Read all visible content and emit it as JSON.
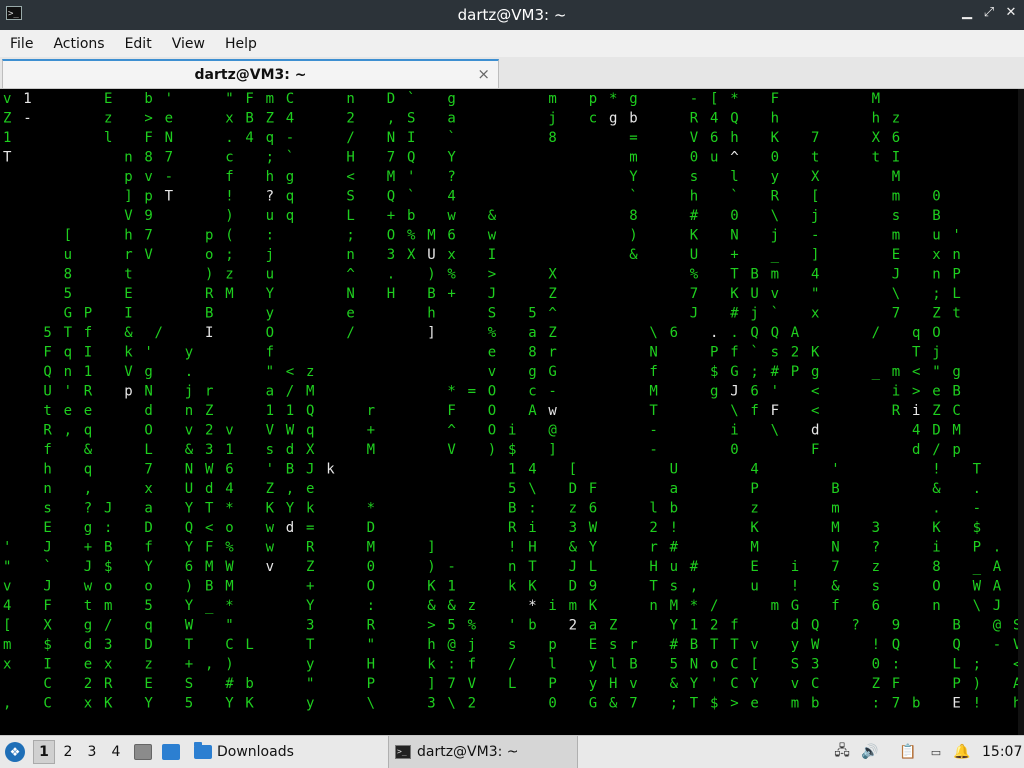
{
  "window": {
    "title": "dartz@VM3: ~",
    "app_icon_glyph": ">_",
    "min_glyph": "▁",
    "max_glyph": "⤢",
    "close_glyph": "✕"
  },
  "menu": {
    "items": [
      "File",
      "Actions",
      "Edit",
      "View",
      "Help"
    ]
  },
  "tab": {
    "label": "dartz@VM3: ~",
    "close_glyph": "×"
  },
  "terminal": {
    "fg_green": "#1fcf1f",
    "fg_white": "#e8e8e8",
    "bg": "#000000",
    "rows": [
      "v 1       E   b '     \" F m C     n   D `   g         m   p * g     - [ *   F         M",
      "Z -       z   > e     x B Z 4     2   , S   a         j   c g b     R 4 Q   h         h z",
      "1         l   F N     . 4 q -     /   N I   `         8       =     V 6 h   K   7     X 6",
      "T           n 8 7     c   ; `     H   7 Q   Y                 m     0 u ^   0   t     t I",
      "            p v -     f   h g     <   M '   ?                 Y     s   l   y   X       M",
      "            ] p T     !   ? q     S   Q `   4                 `     h   `   R   [       m   0",
      "            V 9       )   u q     L   + b   w   &             8     #   0   \\   j       s   B",
      "      [     h 7     p (   :       ;   O % M 6   w             )     K   N   j   -       m   u '",
      "      u     r V     o ;   j       n   3 X U x   I             &     U   +   _   ]       E   x n",
      "      8     t       ) z   u       ^   .   ) %   >     X             %   T B m   4       J   n P",
      "      5     E       R M   Y       N   H   B +   J     Z             7   K U v   \"       \\   ; L",
      "      G P   I       B     y       e       h     S   5 ^             J   # j `   x       7   Z t",
      "    5 T f   &  /    I     O       /       ]     %   a Z         \\ 6   . . Q Q A       /   q O",
      "    F q I   k '   y       f                     e   8 r         N     P f ` s 2 K         T j",
      "    Q n 1   V g   .       \" < z                 v   g G         f     $ G ; # P g     _ m < \" g",
      "    U ' R   p N   j r     a / M             * = O   c -         M     g J 6 '   <       i > e B",
      "    t e e     d   n Z     1 1 Q     r       F   O   A w         T       \\ f F   <       R i Z C",
      "    R , q     O   v 2 v   V W q     +       ^   O i   @         -       i   \\   d         4 D M",
      "    f   &     L   & 3 1   s d X     M       V   ) $   ]         -       0       F         d / p",
      "    h   q     7   N W 6   ' B J k                 1 4   [         U       4       '         !   T",
      "    n   ,     x   U d 4   Z , e                   5 \\   D F       a       P       B         &   .",
      "    s   ? J   a   Y T *   K Y k     *             B :   z 6     l b       z       m         .   -",
      "    E   g :   D   Q < o   w d =     D             R i   3 W     2 !       K       M   3     K   $",
      "'   J   + B   f   Y F %   w   R     M     ]       ! H   & Y     r #       M       N   ?     i   P .",
      "\"   `   J $   Y   6 M W   v   Z     0     ) -     n T   J L     H u #     E   i   7   z     8   _ A",
      "v   J   w o   o   ) B M       +     O     K 1     k K   D 9     T s ,     u   !   &   s     O   W A",
      "4   F   t m   5   Y _ *       Y     :     & & z     * i m K     n M * /     m G   f   6     n   \\ J",
      "[   X   g /   q   W   \"       3     R     > 5 %   ' b   2 a Z     Y 1 2 f     d Q   ?   9     B   @ S",
      "m   $   d 3   D   T   C L     T     \"     h @ j   s   p   E s r   # B T T v   y W     ! Q     Q   - V",
      "x   I   e x   z   + , )       y     H     k : f   /   l   y l B   5 N o C [   S 3     0 :     L ;   <",
      "    C   2 R   E   S   # b     \"     P     ] 7 V   L   P   y H v   & Y ' C Y   v C     Z F     P )   A",
      ",   C   x K   Y   5   Y K     y     \\     3 \\ 2       0   G & 7   ; T $ > e   m b     : 7 b   E !   h"
    ],
    "white_chars": [
      {
        "r": 0,
        "c": 2
      },
      {
        "r": 1,
        "c": 2
      },
      {
        "r": 2,
        "c": 12
      },
      {
        "r": 3,
        "c": 0
      },
      {
        "r": 5,
        "c": 16
      },
      {
        "r": 5,
        "c": 26
      },
      {
        "r": 8,
        "c": 15
      },
      {
        "r": 8,
        "c": 42
      },
      {
        "r": 10,
        "c": 23
      },
      {
        "r": 10,
        "c": 39
      },
      {
        "r": 10,
        "c": 47
      },
      {
        "r": 12,
        "c": 20
      },
      {
        "r": 12,
        "c": 36
      },
      {
        "r": 12,
        "c": 42
      },
      {
        "r": 12,
        "c": 70
      },
      {
        "r": 1,
        "c": 60
      },
      {
        "r": 1,
        "c": 62
      },
      {
        "r": 2,
        "c": 56
      },
      {
        "r": 3,
        "c": 72
      },
      {
        "r": 3,
        "c": 84
      },
      {
        "r": 8,
        "c": 64
      },
      {
        "r": 14,
        "c": 82
      },
      {
        "r": 15,
        "c": 12
      },
      {
        "r": 15,
        "c": 72
      },
      {
        "r": 16,
        "c": 76
      },
      {
        "r": 16,
        "c": 54
      },
      {
        "r": 16,
        "c": 90
      },
      {
        "r": 17,
        "c": 80
      },
      {
        "r": 17,
        "c": 52
      },
      {
        "r": 18,
        "c": 38
      },
      {
        "r": 18,
        "c": 46
      },
      {
        "r": 18,
        "c": 100
      },
      {
        "r": 19,
        "c": 32
      },
      {
        "r": 22,
        "c": 28
      },
      {
        "r": 24,
        "c": 26
      },
      {
        "r": 25,
        "c": 76
      },
      {
        "r": 26,
        "c": 52
      },
      {
        "r": 27,
        "c": 56
      },
      {
        "r": 29,
        "c": 48
      },
      {
        "r": 31,
        "c": 94
      }
    ]
  },
  "taskbar": {
    "workspaces": [
      "1",
      "2",
      "3",
      "4"
    ],
    "active_workspace": "1",
    "folder_label": "Downloads",
    "task_label": "dartz@VM3: ~",
    "clock": "15:07",
    "start_glyph": "❖",
    "volume_glyph": "🔊",
    "clipboard_glyph": "📋",
    "network_glyph": "🖧",
    "notify_glyph": "🔔"
  }
}
